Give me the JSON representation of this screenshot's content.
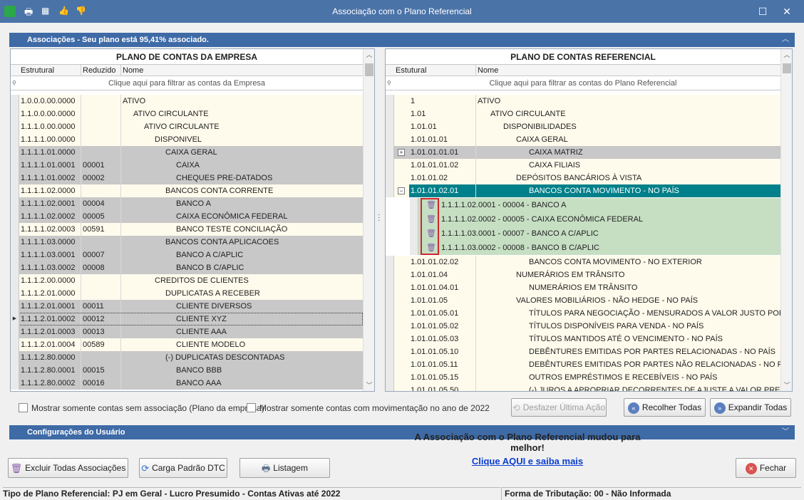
{
  "window": {
    "title": "Associação com o Plano Referencial",
    "maximize_glyph": "☐",
    "close_glyph": "✕"
  },
  "toolbar_icons": [
    "app-icon",
    "print-icon",
    "calendar-icon",
    "thumbs-up-icon",
    "thumbs-down-icon"
  ],
  "associations_bar": {
    "label": "Associações - Seu plano está 95,41% associado."
  },
  "left_grid": {
    "caption": "PLANO DE CONTAS DA EMPRESA",
    "columns": [
      "Estrutural",
      "Reduzido",
      "Nome"
    ],
    "filter_placeholder": "Clique aqui para filtrar as contas da Empresa",
    "rows": [
      {
        "estrutural": "1.0.0.0.00.0000",
        "reduzido": "",
        "nome": "ATIVO",
        "indent": 0,
        "style": "cream"
      },
      {
        "estrutural": "1.1.0.0.00.0000",
        "reduzido": "",
        "nome": "ATIVO CIRCULANTE",
        "indent": 1,
        "style": "cream"
      },
      {
        "estrutural": "1.1.1.0.00.0000",
        "reduzido": "",
        "nome": "ATIVO CIRCULANTE",
        "indent": 2,
        "style": "cream"
      },
      {
        "estrutural": "1.1.1.1.00.0000",
        "reduzido": "",
        "nome": "DISPONIVEL",
        "indent": 3,
        "style": "cream"
      },
      {
        "estrutural": "1.1.1.1.01.0000",
        "reduzido": "",
        "nome": "CAIXA GERAL",
        "indent": 4,
        "style": "gray"
      },
      {
        "estrutural": "1.1.1.1.01.0001",
        "reduzido": "00001",
        "nome": "CAIXA",
        "indent": 5,
        "style": "gray"
      },
      {
        "estrutural": "1.1.1.1.01.0002",
        "reduzido": "00002",
        "nome": "CHEQUES PRE-DATADOS",
        "indent": 5,
        "style": "gray"
      },
      {
        "estrutural": "1.1.1.1.02.0000",
        "reduzido": "",
        "nome": "BANCOS CONTA CORRENTE",
        "indent": 4,
        "style": "cream"
      },
      {
        "estrutural": "1.1.1.1.02.0001",
        "reduzido": "00004",
        "nome": "BANCO A",
        "indent": 5,
        "style": "gray"
      },
      {
        "estrutural": "1.1.1.1.02.0002",
        "reduzido": "00005",
        "nome": "CAIXA ECONÔMICA FEDERAL",
        "indent": 5,
        "style": "gray"
      },
      {
        "estrutural": "1.1.1.1.02.0003",
        "reduzido": "00591",
        "nome": "BANCO TESTE CONCILIAÇÃO",
        "indent": 5,
        "style": "cream"
      },
      {
        "estrutural": "1.1.1.1.03.0000",
        "reduzido": "",
        "nome": "BANCOS CONTA APLICACOES",
        "indent": 4,
        "style": "gray"
      },
      {
        "estrutural": "1.1.1.1.03.0001",
        "reduzido": "00007",
        "nome": "BANCO A C/APLIC",
        "indent": 5,
        "style": "gray"
      },
      {
        "estrutural": "1.1.1.1.03.0002",
        "reduzido": "00008",
        "nome": "BANCO B C/APLIC",
        "indent": 5,
        "style": "gray"
      },
      {
        "estrutural": "1.1.1.2.00.0000",
        "reduzido": "",
        "nome": "CREDITOS DE CLIENTES",
        "indent": 3,
        "style": "cream"
      },
      {
        "estrutural": "1.1.1.2.01.0000",
        "reduzido": "",
        "nome": "DUPLICATAS A RECEBER",
        "indent": 4,
        "style": "cream"
      },
      {
        "estrutural": "1.1.1.2.01.0001",
        "reduzido": "00011",
        "nome": "CLIENTE DIVERSOS",
        "indent": 5,
        "style": "gray"
      },
      {
        "estrutural": "1.1.1.2.01.0002",
        "reduzido": "00012",
        "nome": "CLIENTE XYZ",
        "indent": 5,
        "style": "sel"
      },
      {
        "estrutural": "1.1.1.2.01.0003",
        "reduzido": "00013",
        "nome": "CLIENTE AAA",
        "indent": 5,
        "style": "gray"
      },
      {
        "estrutural": "1.1.1.2.01.0004",
        "reduzido": "00589",
        "nome": "CLIENTE MODELO",
        "indent": 5,
        "style": "cream"
      },
      {
        "estrutural": "1.1.1.2.80.0000",
        "reduzido": "",
        "nome": "(-) DUPLICATAS DESCONTADAS",
        "indent": 4,
        "style": "gray"
      },
      {
        "estrutural": "1.1.1.2.80.0001",
        "reduzido": "00015",
        "nome": "BANCO BBB",
        "indent": 5,
        "style": "gray"
      },
      {
        "estrutural": "1.1.1.2.80.0002",
        "reduzido": "00016",
        "nome": "BANCO AAA",
        "indent": 5,
        "style": "gray"
      }
    ]
  },
  "right_grid": {
    "caption": "PLANO DE CONTAS REFERENCIAL",
    "columns": [
      "Estutural",
      "Nome"
    ],
    "filter_placeholder": "Clique aqui para filtrar as contas do Plano Referencial",
    "rows_top": [
      {
        "estrutural": "1",
        "nome": "ATIVO",
        "indent": 0,
        "style": "cream",
        "expander": ""
      },
      {
        "estrutural": "1.01",
        "nome": "ATIVO CIRCULANTE",
        "indent": 1,
        "style": "cream",
        "expander": ""
      },
      {
        "estrutural": "1.01.01",
        "nome": "DISPONIBILIDADES",
        "indent": 2,
        "style": "cream",
        "expander": ""
      },
      {
        "estrutural": "1.01.01.01",
        "nome": "CAIXA GERAL",
        "indent": 3,
        "style": "cream",
        "expander": ""
      },
      {
        "estrutural": "1.01.01.01.01",
        "nome": "CAIXA MATRIZ",
        "indent": 4,
        "style": "gray",
        "expander": "+"
      },
      {
        "estrutural": "1.01.01.01.02",
        "nome": "CAIXA FILIAIS",
        "indent": 4,
        "style": "cream",
        "expander": ""
      },
      {
        "estrutural": "1.01.01.02",
        "nome": "DEPÓSITOS BANCÁRIOS À VISTA",
        "indent": 3,
        "style": "cream",
        "expander": ""
      },
      {
        "estrutural": "1.01.01.02.01",
        "nome": "BANCOS CONTA MOVIMENTO - NO PAÍS",
        "indent": 4,
        "style": "teal",
        "expander": "−"
      }
    ],
    "associated": [
      "1.1.1.1.02.0001 - 00004 - BANCO A",
      "1.1.1.1.02.0002 - 00005 - CAIXA ECONÔMICA FEDERAL",
      "1.1.1.1.03.0001 - 00007 - BANCO A C/APLIC",
      "1.1.1.1.03.0002 - 00008 - BANCO B C/APLIC"
    ],
    "rows_bottom": [
      {
        "estrutural": "1.01.01.02.02",
        "nome": "BANCOS CONTA MOVIMENTO - NO EXTERIOR",
        "indent": 4
      },
      {
        "estrutural": "1.01.01.04",
        "nome": "NUMERÁRIOS EM TRÂNSITO",
        "indent": 3
      },
      {
        "estrutural": "1.01.01.04.01",
        "nome": "NUMERÁRIOS EM TRÂNSITO",
        "indent": 4
      },
      {
        "estrutural": "1.01.01.05",
        "nome": "VALORES MOBILIÁRIOS - NÃO HEDGE - NO PAÍS",
        "indent": 3
      },
      {
        "estrutural": "1.01.01.05.01",
        "nome": "TÍTULOS PARA NEGOCIAÇÃO - MENSURADOS A VALOR JUSTO POR MEIO",
        "indent": 4
      },
      {
        "estrutural": "1.01.01.05.02",
        "nome": "TÍTULOS DISPONÍVEIS PARA VENDA - NO PAÍS",
        "indent": 4
      },
      {
        "estrutural": "1.01.01.05.03",
        "nome": "TÍTULOS MANTIDOS ATÉ O VENCIMENTO - NO PAÍS",
        "indent": 4
      },
      {
        "estrutural": "1.01.01.05.10",
        "nome": "DEBÊNTURES EMITIDAS POR PARTES RELACIONADAS - NO PAÍS",
        "indent": 4
      },
      {
        "estrutural": "1.01.01.05.11",
        "nome": "DEBÊNTURES EMITIDAS POR PARTES NÃO RELACIONADAS - NO PAÍS",
        "indent": 4
      },
      {
        "estrutural": "1.01.01.05.15",
        "nome": "OUTROS EMPRÉSTIMOS E RECEBÍVEIS - NO PAÍS",
        "indent": 4
      },
      {
        "estrutural": "1.01.01.05.50",
        "nome": "(-) JUROS A APROPRIAR DECORRENTES DE AJUSTE A VALOR PRESENTE",
        "indent": 4
      }
    ]
  },
  "options": {
    "chk_sem_associacao": "Mostrar somente contas sem associação (Plano da empresa)",
    "chk_movimentacao": "Mostrar somente contas com movimentação no ano de 2022",
    "btn_desfazer": "Desfazer Última Ação",
    "btn_recolher": "Recolher Todas",
    "btn_expandir": "Expandir Todas"
  },
  "config_bar": {
    "label": "Configurações do Usuário"
  },
  "footer": {
    "btn_excluir": "Excluir Todas Associações",
    "btn_carga": "Carga Padrão DTC",
    "btn_listagem": "Listagem",
    "news_title": "A Associação com o Plano Referencial mudou para melhor!",
    "news_link": "Clique AQUI e saiba mais",
    "btn_fechar": "Fechar"
  },
  "statusbar": {
    "left": "Tipo de Plano Referencial: PJ em Geral - Lucro Presumido - Contas Ativas até 2022",
    "right": "Forma de Tributação: 00 - Não Informada"
  },
  "colors": {
    "titlebar": "#4a73a8",
    "groupbar": "#3e6aa6",
    "selected_teal": "#00808a",
    "assoc_green": "#c6dfc3",
    "cream": "#fffbec",
    "gray": "#c8c8c8"
  }
}
